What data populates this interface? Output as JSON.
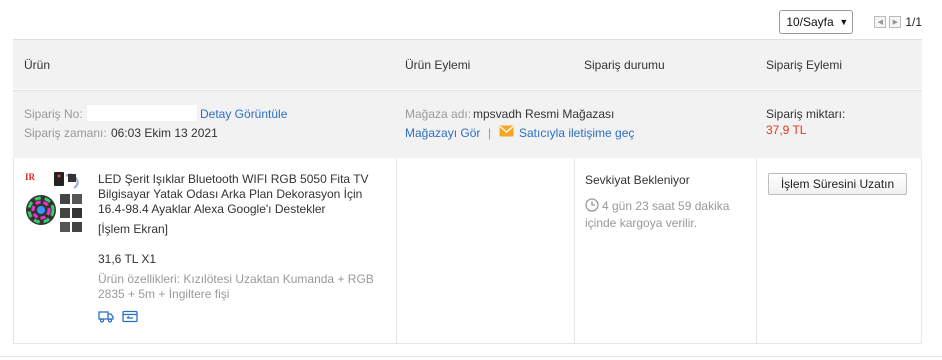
{
  "pagination": {
    "page_size": "10/Sayfa",
    "page_indicator": "1/1"
  },
  "table_header": {
    "product": "Ürün",
    "product_action": "Ürün Eylemi",
    "order_status": "Sipariş durumu",
    "order_action": "Sipariş Eylemi"
  },
  "order": {
    "number_label": "Sipariş No:",
    "number_value": "",
    "detail_link": "Detay Görüntüle",
    "time_label": "Sipariş zamanı:",
    "time_value": "06:03 Ekim 13 2021",
    "store_label": "Mağaza adı:",
    "store_value": "mpsvadh Resmi Mağazası",
    "view_store_link": "Mağazayı Gör",
    "separator": "|",
    "contact_seller_link": "Satıcıyla iletişime geç",
    "total_label": "Sipariş miktarı:",
    "total_value": "37,9 TL"
  },
  "product": {
    "name": "LED Şerit Işıklar Bluetooth WIFI RGB 5050 Fita TV Bilgisayar Yatak Odası Arka Plan Dekorasyon İçin 16.4-98.4 Ayaklar Alexa Google'ı Destekler",
    "screen_link": "[İşlem Ekran]",
    "price": "31,6 TL X1",
    "features": "Ürün özellikleri: Kızılötesi Uzaktan Kumanda + RGB 2835 + 5m + İngiltere fişi",
    "icons": [
      "shipping-truck-icon",
      "card-icon"
    ]
  },
  "status": {
    "text": "Sevkiyat Bekleniyor",
    "timer": "4 gün 23 saat 59 dakika içinde kargoya verilir."
  },
  "action": {
    "extend_button": "İşlem Süresini Uzatın"
  },
  "colors": {
    "link": "#2b6fc4",
    "total": "#e4391b",
    "muted": "#999999",
    "header_bg": "#f2f2f2",
    "mail_icon": "#f5a623"
  }
}
